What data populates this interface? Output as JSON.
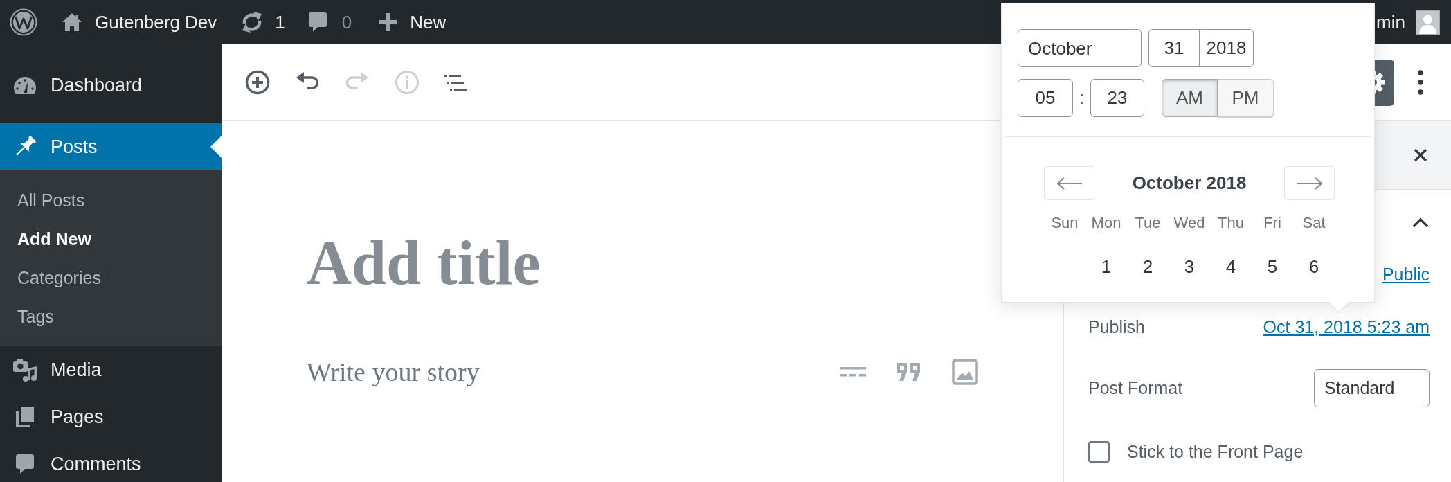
{
  "admin_bar": {
    "site_name": "Gutenberg Dev",
    "updates_count": "1",
    "comments_count": "0",
    "new_label": "New",
    "account_name": "min"
  },
  "admin_menu": [
    {
      "kind": "dashboard",
      "label": "Dashboard",
      "selected": false
    },
    {
      "kind": "posts",
      "label": "Posts",
      "selected": true,
      "submenu": [
        {
          "label": "All Posts",
          "selected": false
        },
        {
          "label": "Add New",
          "selected": true
        },
        {
          "label": "Categories",
          "selected": false
        },
        {
          "label": "Tags",
          "selected": false
        }
      ]
    },
    {
      "kind": "media",
      "label": "Media",
      "selected": false
    },
    {
      "kind": "pages",
      "label": "Pages",
      "selected": false
    },
    {
      "kind": "comments",
      "label": "Comments",
      "selected": false
    }
  ],
  "editor_toolbar": [
    {
      "kind": "inserter",
      "disabled": false
    },
    {
      "kind": "undo",
      "disabled": false
    },
    {
      "kind": "redo",
      "disabled": true
    },
    {
      "kind": "info",
      "disabled": true
    },
    {
      "kind": "outline",
      "disabled": false
    }
  ],
  "settings_button": {
    "pressed": true
  },
  "editor": {
    "title_placeholder": "Add title",
    "paragraph_placeholder": "Write your story",
    "block_shortcuts": [
      {
        "kind": "more"
      },
      {
        "kind": "quote"
      },
      {
        "kind": "image"
      }
    ]
  },
  "sidebar": {
    "panel_expanded": true,
    "visibility": {
      "value": "Public"
    },
    "publish": {
      "label": "Publish",
      "value": "Oct 31, 2018 5:23 am"
    },
    "post_format": {
      "label": "Post Format",
      "value": "Standard"
    },
    "sticky": {
      "label": "Stick to the Front Page",
      "checked": false
    }
  },
  "date_picker": {
    "month": "October",
    "day": "31",
    "year": "2018",
    "hours": "05",
    "time_separator": ":",
    "minutes": "23",
    "meridiem": [
      {
        "label": "AM",
        "selected": true
      },
      {
        "label": "PM",
        "selected": false
      }
    ],
    "calendar": {
      "title": "October 2018",
      "weekdays": [
        "Sun",
        "Mon",
        "Tue",
        "Wed",
        "Thu",
        "Fri",
        "Sat"
      ],
      "weeks": [
        {
          "first_week": true,
          "days": [
            "1",
            "2",
            "3",
            "4",
            "5",
            "6"
          ]
        }
      ]
    }
  }
}
